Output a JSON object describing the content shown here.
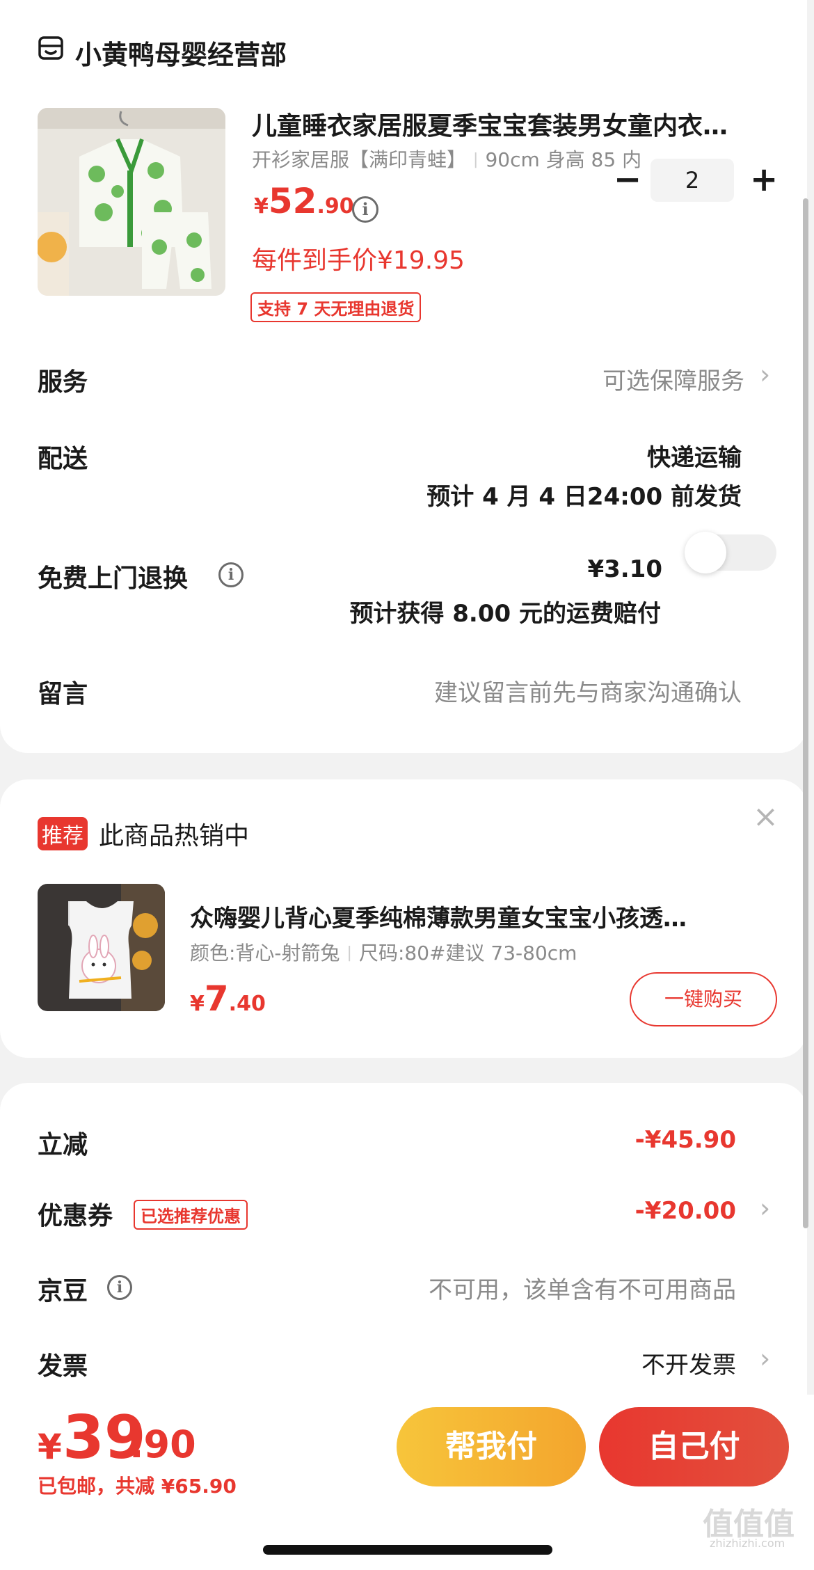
{
  "colors": {
    "accent": "#e8372f",
    "help_pay": "#f5b535",
    "self_pay": "#e8372f"
  },
  "store": {
    "name": "小黄鸭母婴经营部",
    "icon": "store-icon"
  },
  "product": {
    "title": "儿童睡衣家居服夏季宝宝套装男女童内衣…",
    "spec_style": "开衫家居服【满印青蛙】",
    "spec_size": "90cm 身高 85 内",
    "price_symbol": "¥",
    "price_int": "52",
    "price_dec": ".90",
    "unit_price": "每件到手价¥19.95",
    "return_tag": "支持 7 天无理由退货",
    "quantity": "2",
    "minus": "−",
    "plus": "+"
  },
  "rows": {
    "service": {
      "label": "服务",
      "value": "可选保障服务"
    },
    "delivery": {
      "label": "配送",
      "method": "快递运输",
      "eta": "预计 4 月 4 日24:00 前发货"
    },
    "free_return": {
      "label": "免费上门退换",
      "price": "¥3.10",
      "note": "预计获得 8.00 元的运费赔付",
      "enabled": false
    },
    "message": {
      "label": "留言",
      "placeholder": "建议留言前先与商家沟通确认"
    }
  },
  "recommend": {
    "badge": "推荐",
    "heading": "此商品热销中",
    "close": "×",
    "title": "众嗨婴儿背心夏季纯棉薄款男童女宝宝小孩透…",
    "spec_color": "颜色:背心-射箭兔",
    "spec_size": "尺码:80#建议 73-80cm",
    "price_symbol": "¥",
    "price_int": "7",
    "price_dec": ".40",
    "buy_label": "一键购买"
  },
  "pricing": {
    "discount": {
      "label": "立减",
      "value": "-¥45.90"
    },
    "coupon": {
      "label": "优惠券",
      "tag": "已选推荐优惠",
      "value": "-¥20.00"
    },
    "beans": {
      "label": "京豆",
      "value": "不可用，该单含有不可用商品"
    },
    "invoice": {
      "label": "发票",
      "value": "不开发票"
    }
  },
  "footer": {
    "total_symbol": "¥",
    "total_int": "39",
    "total_dec": ".90",
    "note": "已包邮，共减 ¥65.90",
    "help_pay": "帮我付",
    "self_pay": "自己付"
  },
  "watermark": {
    "text": "值值值",
    "sub": "zhizhizhi.com"
  }
}
